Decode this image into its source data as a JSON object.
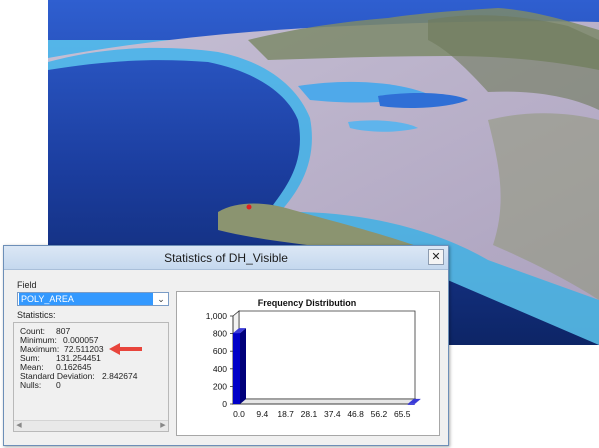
{
  "dialog": {
    "title": "Statistics of DH_Visible",
    "close_glyph": "✕",
    "field_label": "Field",
    "field_value": "POLY_AREA",
    "statistics_label": "Statistics:",
    "stats": [
      {
        "label": "Count:",
        "value": "807"
      },
      {
        "label": "Minimum:",
        "value": "0.000057"
      },
      {
        "label": "Maximum:",
        "value": "72.511203"
      },
      {
        "label": "Sum:",
        "value": "131.254451"
      },
      {
        "label": "Mean:",
        "value": "0.162645"
      },
      {
        "label": "Standard Deviation:",
        "value": "2.842674"
      },
      {
        "label": "Nulls:",
        "value": "0"
      }
    ],
    "annotation_color": "#e8453c"
  },
  "chart_data": {
    "type": "bar",
    "title": "Frequency Distribution",
    "xlabel": "",
    "ylabel": "",
    "x_tick_labels": [
      "0.0",
      "9.4",
      "18.7",
      "28.1",
      "37.4",
      "46.8",
      "56.2",
      "65.5"
    ],
    "y_tick_labels": [
      "0",
      "200",
      "400",
      "600",
      "800",
      "1,000"
    ],
    "ylim": [
      0,
      1000
    ],
    "xlim": [
      0,
      72.51
    ],
    "bars": [
      {
        "x": 0.0,
        "value": 806
      },
      {
        "x": 72.0,
        "value": 1
      }
    ],
    "bar_color": "#0000c8",
    "grid": false
  },
  "colors": {
    "ocean": "#1a3f9c",
    "shore": "#59c6ee",
    "terrain": "#b9b0c9"
  }
}
